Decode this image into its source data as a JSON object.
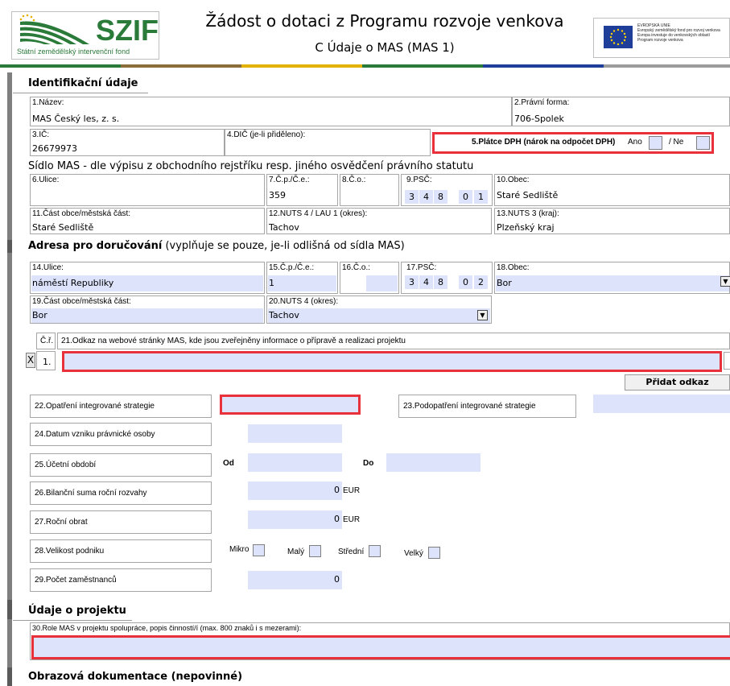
{
  "header": {
    "logo_text": "SZIF",
    "logo_subtitle": "Státní zemědělský intervenční fond",
    "title": "Žádost o dotaci z Programu rozvoje venkova",
    "subtitle": "C Údaje o MAS (MAS 1)",
    "eu_text_lines": [
      "EVROPSKÁ UNIE",
      "Evropský zemědělský fond pro rozvoj venkova",
      "Evropa investuje do venkovských oblastí",
      "Program rozvoje venkova"
    ],
    "colors": {
      "brand_green": "#2a7a3a",
      "eu_blue": "#1f3e99"
    }
  },
  "sections": {
    "identification": "Identifikační údaje",
    "seat": "Sídlo MAS - dle výpisu z obchodního rejstříku resp. jiného osvědčení právního statutu",
    "delivery_bold": "Adresa pro doručování",
    "delivery_note": " (vyplňuje se pouze, je-li odlišná od sídla MAS)",
    "project": "Údaje o projektu",
    "images": "Obrazová dokumentace (nepovinné)"
  },
  "ident": {
    "name_label": "1.Název:",
    "name_value": "MAS Český les, z. s.",
    "legal_label": "2.Právní forma:",
    "legal_value": "706-Spolek",
    "ic_label": "3.IČ:",
    "ic_value": "26679973",
    "dic_label": "4.DIČ (je-li přiděleno):",
    "vat_label": "5.Plátce DPH (nárok na odpočet DPH)",
    "vat_yes": "Ano",
    "vat_no": "/ Ne"
  },
  "seat": {
    "street_label": "6.Ulice:",
    "cp_label": "7.Č.p./Č.e.:",
    "cp_value": "359",
    "co_label": "8.Č.o.:",
    "psc_label": "9.PSČ:",
    "psc_digits": [
      "3",
      "4",
      "8",
      "0",
      "1"
    ],
    "city_label": "10.Obec:",
    "city_value": "Staré Sedliště",
    "part_label": "11.Část obce/městská část:",
    "part_value": "Staré Sedliště",
    "nuts4_label": "12.NUTS 4 / LAU 1 (okres):",
    "nuts4_value": "Tachov",
    "nuts3_label": "13.NUTS 3 (kraj):",
    "nuts3_value": "Plzeňský kraj"
  },
  "delivery": {
    "street_label": "14.Ulice:",
    "street_value": "náměstí Republiky",
    "cp_label": "15.Č.p./Č.e.:",
    "cp_value": "1",
    "co_label": "16.Č.o.:",
    "psc_label": "17.PSČ:",
    "psc_digits": [
      "3",
      "4",
      "8",
      "0",
      "2"
    ],
    "city_label": "18.Obec:",
    "city_value": "Bor",
    "part_label": "19.Část obce/městská část:",
    "part_value": "Bor",
    "nuts4_label": "20.NUTS 4 (okres):",
    "nuts4_value": "Tachov"
  },
  "links": {
    "col_num": "Č.ř.",
    "col_label": "21.Odkaz na webové stránky MAS, kde jsou zveřejněny informace o přípravě a realizaci projektu",
    "delete": "X",
    "row_num": "1.",
    "add_button": "Přidat odkaz"
  },
  "fields": {
    "f22": "22.Opatření integrované strategie",
    "f23": "23.Podopatření integrované strategie",
    "f24": "24.Datum vzniku právnické osoby",
    "f25": "25.Účetní období",
    "from": "Od",
    "to": "Do",
    "f26": "26.Bilanční suma roční rozvahy",
    "f26_value": "0",
    "f26_unit": "EUR",
    "f27": "27.Roční obrat",
    "f27_value": "0",
    "f27_unit": "EUR",
    "f28": "28.Velikost podniku",
    "sizes": [
      "Mikro",
      "Malý",
      "Střední",
      "Velký"
    ],
    "f29": "29.Počet zaměstnanců",
    "f29_value": "0",
    "f30": "30.Role MAS v projektu spolupráce, popis činností/í (max. 800 znaků i s mezerami):"
  }
}
